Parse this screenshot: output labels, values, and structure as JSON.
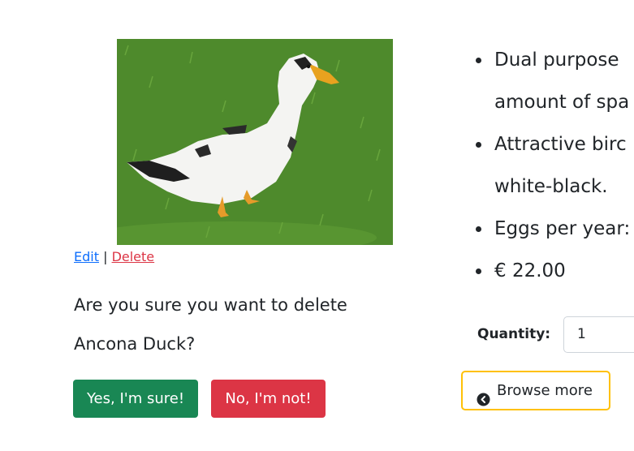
{
  "product": {
    "image_alt": "Ancona Duck",
    "admin": {
      "edit_label": "Edit",
      "separator": "|",
      "delete_label": "Delete"
    },
    "confirm": {
      "question": "Are you sure you want to delete Ancona Duck?",
      "yes_label": "Yes, I'm sure!",
      "no_label": "No, I'm not!"
    },
    "details": {
      "bullet_1_line_1": "Dual purpose",
      "bullet_1_line_2": "amount of spa",
      "bullet_2_line_1": "Attractive birc",
      "bullet_2_line_2": "white-black.",
      "bullet_3": "Eggs per year:",
      "price": "€ 22.00"
    },
    "quantity": {
      "label": "Quantity:",
      "value": "1"
    },
    "browse_label": "Browse more",
    "colors": {
      "yes": "#198754",
      "no": "#dc3545",
      "browse_border": "#ffc107",
      "edit_link": "#0d6efd"
    }
  }
}
